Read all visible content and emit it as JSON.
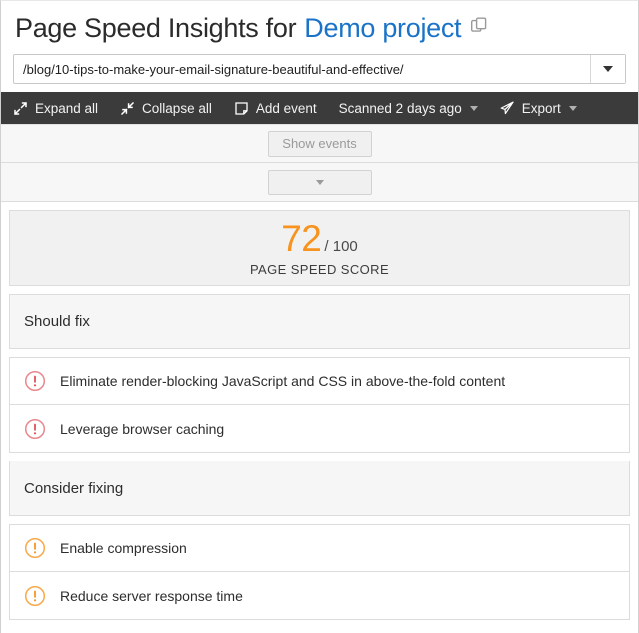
{
  "header": {
    "title_prefix": "Page Speed Insights for",
    "project_name": "Demo project",
    "copy_icon": "copy-icon"
  },
  "url_field": {
    "value": "/blog/10-tips-to-make-your-email-signature-beautiful-and-effective/",
    "placeholder": "Enter URL",
    "dropdown_icon": "chevron-down-icon"
  },
  "toolbar": {
    "items": [
      {
        "label": "Expand all",
        "icon": "expand-arrows-icon",
        "caret": false
      },
      {
        "label": "Collapse all",
        "icon": "collapse-arrows-icon",
        "caret": false
      },
      {
        "label": "Add event",
        "icon": "note-page-icon",
        "caret": false
      },
      {
        "label": "Scanned 2 days ago",
        "icon": "",
        "caret": true
      },
      {
        "label": "Export",
        "icon": "paper-plane-icon",
        "caret": true
      }
    ]
  },
  "strips": {
    "show_events_label": "Show events",
    "collapse_caret_icon": "chevron-down-icon"
  },
  "score": {
    "value": "72",
    "denominator": "/ 100",
    "label": "PAGE SPEED SCORE",
    "value_color": "#f7931e"
  },
  "sections": [
    {
      "heading": "Should fix",
      "severity": "high",
      "severity_color": "#e8595f",
      "items": [
        {
          "label": "Eliminate render-blocking JavaScript and CSS in above-the-fold content",
          "icon": "exclamation-circle-icon"
        },
        {
          "label": "Leverage browser caching",
          "icon": "exclamation-circle-icon"
        }
      ]
    },
    {
      "heading": "Consider fixing",
      "severity": "medium",
      "severity_color": "#f7931e",
      "items": [
        {
          "label": "Enable compression",
          "icon": "exclamation-circle-icon"
        },
        {
          "label": "Reduce server response time",
          "icon": "exclamation-circle-icon"
        }
      ]
    }
  ]
}
